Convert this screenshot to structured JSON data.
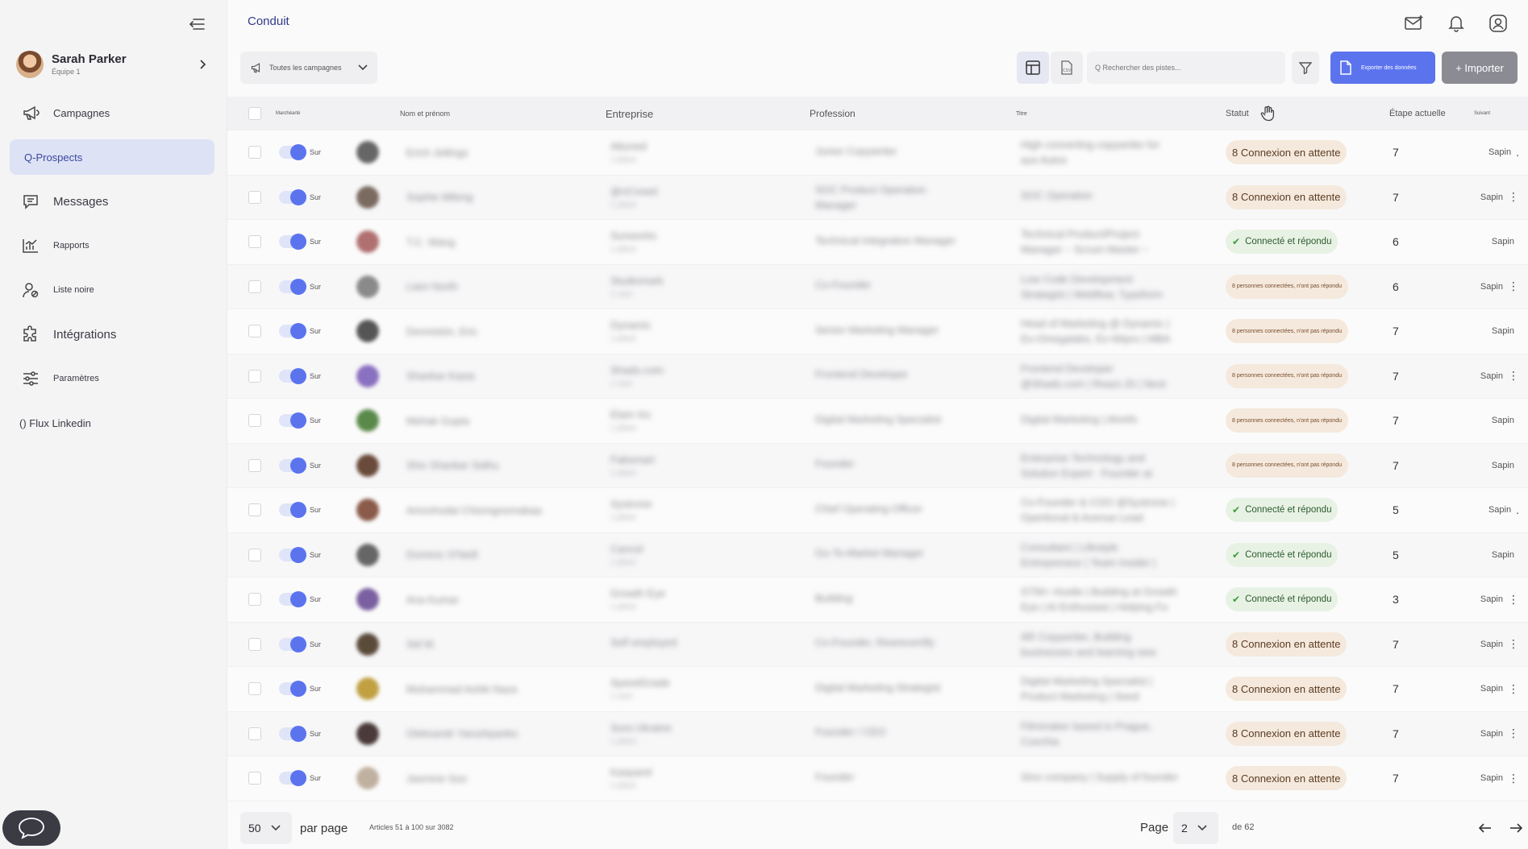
{
  "sidebar": {
    "user": {
      "name": "Sarah Parker",
      "team": "Équipe 1"
    },
    "items": [
      {
        "label": "Campagnes",
        "icon": "megaphone-icon"
      },
      {
        "label": "Q-Prospects",
        "icon": ""
      },
      {
        "label": "Messages",
        "icon": "message-icon"
      },
      {
        "label": "Rapports",
        "icon": "chart-icon"
      },
      {
        "label": "Liste noire",
        "icon": "user-block-icon"
      },
      {
        "label": "Intégrations",
        "icon": "puzzle-icon"
      },
      {
        "label": "Paramètres",
        "icon": "sliders-icon"
      },
      {
        "label": "() Flux Linkedin",
        "icon": ""
      }
    ]
  },
  "header": {
    "title": "Conduit"
  },
  "toolbar": {
    "campaign_select": "Toutes les campagnes",
    "search_placeholder": "Q Rechercher des pistes...",
    "export_label": "Exporter des données",
    "import_label": "+ Importer"
  },
  "table": {
    "headers": {
      "marketing": "Marchéarté",
      "name": "Nom et prénom",
      "company": "Entreprise",
      "profession": "Profession",
      "title": "Titre",
      "status": "Statut",
      "stage": "Étape actuelle",
      "follow": "Suivant"
    },
    "rows": [
      {
        "toggle": "Sur",
        "name": "Erich Jellings",
        "company": "Attuned",
        "company_sub": "1 place",
        "profession": "Junior Copywriter",
        "title": "High converting copywriter for",
        "title2": "aus Autos",
        "status": "8 Connexion en attente",
        "status_type": "wait",
        "stage": "7",
        "follow": "Sapin",
        "kebab": "."
      },
      {
        "toggle": "Sur",
        "name": "Sophie Mileng",
        "company": "@nCrowd",
        "company_sub": "1 place",
        "profession": "SOC Product Operation",
        "profession2": "Manager",
        "title": "SOC Operation",
        "title2": "",
        "status": "8 Connexion en attente",
        "status_type": "wait",
        "stage": "7",
        "follow": "Sapin",
        "kebab": "⋮"
      },
      {
        "toggle": "Sur",
        "name": "T.C. Wang",
        "company": "Sunworks",
        "company_sub": "1 place",
        "profession": "Technical Integration Manager",
        "title": "Technical Product/Project",
        "title2": "Manager ~ Scrum Master ~",
        "status": "Connecté et répondu",
        "status_type": "done",
        "stage": "6",
        "follow": "Sapin",
        "kebab": ""
      },
      {
        "toggle": "Sur",
        "name": "Liam North",
        "company": "Studiomark",
        "company_sub": "1 user",
        "profession": "Co-Founder",
        "title": "Low Code Development",
        "title2": "Strategist | Webflow, Typeform",
        "status": "8 personnes connectées, n'ont pas répondu",
        "status_type": "pers",
        "stage": "6",
        "follow": "Sapin",
        "kebab": "⋮"
      },
      {
        "toggle": "Sur",
        "name": "Dennistón, Eric",
        "company": "Dynamic",
        "company_sub": "1 place",
        "profession": "Senior Marketing Manager",
        "title": "Head of Marketing @ Dynamic |",
        "title2": "Ex-Omegalabs, Ex-Wipro | MBA",
        "status": "8 personnes connectées, n'ont pas répondu",
        "status_type": "pers",
        "stage": "7",
        "follow": "Sapin",
        "kebab": ""
      },
      {
        "toggle": "Sur",
        "name": "Shankar Kasia",
        "company": "Shado.com",
        "company_sub": "1 user",
        "profession": "Frontend Developer",
        "title": "Frontend Developer",
        "title2": "@Shado.com | React.JS | Next",
        "status": "8 personnes connectées, n'ont pas répondu",
        "status_type": "pers",
        "stage": "7",
        "follow": "Sapin",
        "kebab": "⋮"
      },
      {
        "toggle": "Sur",
        "name": "Mehak Gupta",
        "company": "Elam Inc",
        "company_sub": "1 place",
        "profession": "Digital Marketing Specialist",
        "title": "Digital Marketing | Ahrefs",
        "title2": "",
        "status": "8 personnes connectées, n'ont pas répondu",
        "status_type": "pers",
        "stage": "7",
        "follow": "Sapin",
        "kebab": ""
      },
      {
        "toggle": "Sur",
        "name": "Shiv Shankar Sidhu",
        "company": "Fabsmart",
        "company_sub": "1 place",
        "profession": "Founder",
        "title": "Enterprise Technology and",
        "title2": "Solution Expert · Founder at",
        "status": "8 personnes connectées, n'ont pas répondu",
        "status_type": "pers",
        "stage": "7",
        "follow": "Sapin",
        "kebab": ""
      },
      {
        "toggle": "Sur",
        "name": "Amoshodai Chiomgnomabaa",
        "company": "Systrone",
        "company_sub": "1 place",
        "profession": "Chief Operating Officer",
        "title": "Co-Founder & COO @Systrone |",
        "title2": "Opertional & Avenue Lead",
        "status": "Connecté et répondu",
        "status_type": "done",
        "stage": "5",
        "follow": "Sapin",
        "kebab": "."
      },
      {
        "toggle": "Sur",
        "name": "Dominic O'Neill",
        "company": "Cancel",
        "company_sub": "1 place",
        "profession": "Go-To-Market Manager",
        "title": "Consultant | Lifestyle",
        "title2": "Entrepreneur | Team Insider |",
        "status": "Connecté et répondu",
        "status_type": "done",
        "stage": "5",
        "follow": "Sapin",
        "kebab": ""
      },
      {
        "toggle": "Sur",
        "name": "Ana Kumar",
        "company": "Growth Eye",
        "company_sub": "1 place",
        "profession": "Building",
        "title": "GTM+ Hustle | Building at Growth",
        "title2": "Eye | AI Enthusiast | Helping Fo",
        "status": "Connecté et répondu",
        "status_type": "done",
        "stage": "3",
        "follow": "Sapin",
        "kebab": "⋮"
      },
      {
        "toggle": "Sur",
        "name": "Sid M.",
        "company": "Self employed",
        "company_sub": "",
        "profession": "Co-Founder, Rewrevertify",
        "title": "AR Copywriter, Building",
        "title2": "businesses and learning new",
        "status": "8 Connexion en attente",
        "status_type": "wait",
        "stage": "7",
        "follow": "Sapin",
        "kebab": "⋮"
      },
      {
        "toggle": "Sur",
        "name": "Muhammad Ashik Naza",
        "company": "SpeedGrade",
        "company_sub": "1 user",
        "profession": "Digital Marketing Strategist",
        "title": "Digital Marketing Specialist |",
        "title2": "Product Marketing | Seed",
        "status": "8 Connexion en attente",
        "status_type": "wait",
        "stage": "7",
        "follow": "Sapin",
        "kebab": "⋮"
      },
      {
        "toggle": "Sur",
        "name": "Oleksandr Yaroshpanko",
        "company": "Sora Ukraine",
        "company_sub": "1 place",
        "profession": "Founder / CEO",
        "title": "Filmmaker based in Prague,",
        "title2": "Czechia",
        "status": "8 Connexion en attente",
        "status_type": "wait",
        "stage": "7",
        "follow": "Sapin",
        "kebab": "⋮"
      },
      {
        "toggle": "Sur",
        "name": "Jasmine Soo",
        "company": "Kasparel",
        "company_sub": "1 place",
        "profession": "Founder",
        "title": "Sino company | Supply of founder",
        "title2": "",
        "status": "8 Connexion en attente",
        "status_type": "wait",
        "stage": "7",
        "follow": "Sapin",
        "kebab": "⋮"
      }
    ]
  },
  "footer": {
    "per_page_value": "50",
    "per_page_label": "par page",
    "range": "Articles 51 à 100 sur 3082",
    "page_label": "Page",
    "page_value": "2",
    "of_label": "de 62"
  },
  "colors": {
    "accent": "#5b74ee",
    "active_nav": "#dde2f5",
    "wait_badge": "#f4e9dc",
    "done_badge": "#e7f2e4"
  }
}
